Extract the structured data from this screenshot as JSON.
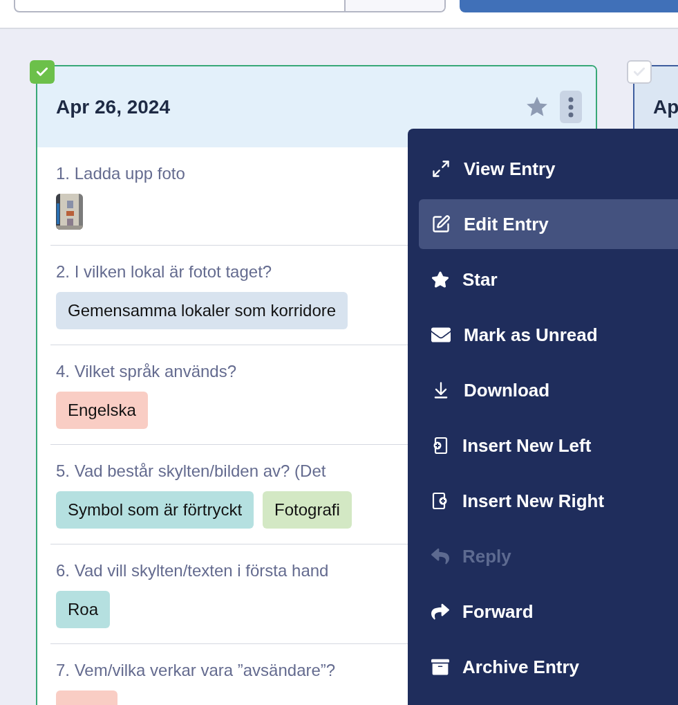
{
  "cards": [
    {
      "title": "Apr 26, 2024",
      "checked": true,
      "starred": false,
      "questions": [
        {
          "label": "1. Ladda upp foto"
        },
        {
          "label": "2. I vilken lokal är fotot taget?",
          "kind": "tags",
          "tags": [
            {
              "label": "Gemensamma lokaler som korridore",
              "color": "#d8e3ef"
            }
          ]
        },
        {
          "label": "4. Vilket språk används?",
          "kind": "tags",
          "tags": [
            {
              "label": "Engelska",
              "color": "#f9cdc4"
            }
          ]
        },
        {
          "label": "5. Vad består skylten/bilden av? (Det",
          "kind": "tags",
          "tags": [
            {
              "label": "Symbol som är förtryckt",
              "color": "#b5e0e0"
            },
            {
              "label": "Fotografi",
              "color": "#d3e8c4"
            }
          ]
        },
        {
          "label": "6. Vad vill skylten/texten i första hand",
          "kind": "tags",
          "tags": [
            {
              "label": "Roa",
              "color": "#b5e0e0"
            }
          ]
        },
        {
          "label": "7. Vem/vilka verkar vara ”avsändare”?",
          "kind": "cut",
          "color": "#f9cdc4"
        }
      ]
    },
    {
      "title": "Ap",
      "checked": false
    }
  ],
  "menu": {
    "items": [
      {
        "label": "View Entry",
        "selected": false,
        "disabled": false
      },
      {
        "label": "Edit Entry",
        "selected": true,
        "disabled": false
      },
      {
        "label": "Star",
        "selected": false,
        "disabled": false
      },
      {
        "label": "Mark as Unread",
        "selected": false,
        "disabled": false
      },
      {
        "label": "Download",
        "selected": false,
        "disabled": false
      },
      {
        "label": "Insert New Left",
        "selected": false,
        "disabled": false
      },
      {
        "label": "Insert New Right",
        "selected": false,
        "disabled": false
      },
      {
        "label": "Reply",
        "selected": false,
        "disabled": true
      },
      {
        "label": "Forward",
        "selected": false,
        "disabled": false
      },
      {
        "label": "Archive Entry",
        "selected": false,
        "disabled": false
      }
    ]
  }
}
